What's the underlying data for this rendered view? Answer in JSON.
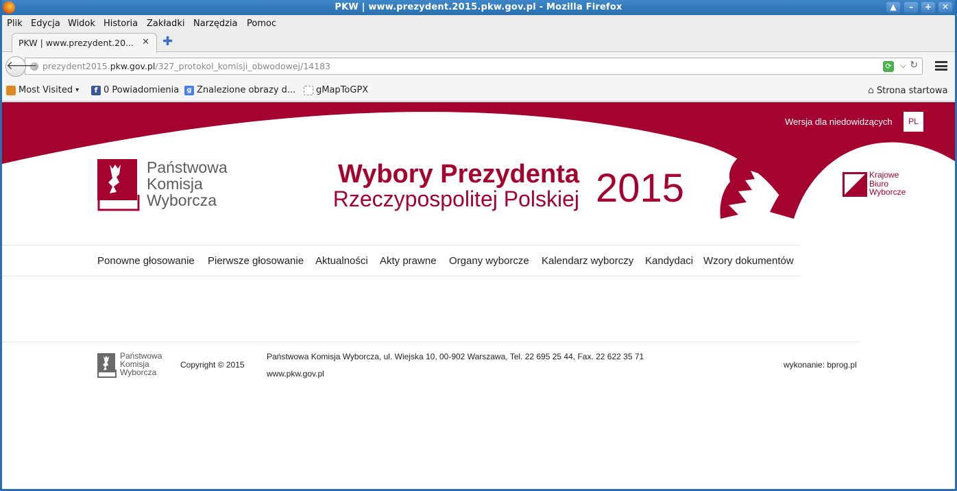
{
  "window": {
    "title": "PKW | www.prezydent.2015.pkw.gov.pl - Mozilla Firefox",
    "controls": [
      "▲",
      "–",
      "+",
      "✕"
    ]
  },
  "menu": [
    "Plik",
    "Edycja",
    "Widok",
    "Historia",
    "Zakładki",
    "Narzędzia",
    "Pomoc"
  ],
  "tab": {
    "title": "PKW | www.prezydent.20...",
    "close": "✕",
    "new_tab": "✚"
  },
  "address": {
    "prefix": "prezydent2015.",
    "domain": "pkw.gov.pl",
    "path": "/327_protokol_komisji_obwodowej/14183"
  },
  "bookmarks": {
    "items": [
      {
        "label": "Most Visited",
        "icon": "folder-icon",
        "color": "#e08a1e"
      },
      {
        "label": "0 Powiadomienia",
        "icon": "facebook-icon",
        "color": "#3b5998"
      },
      {
        "label": "Znalezione obrazy d...",
        "icon": "google-icon",
        "color": "#4a7ef0"
      },
      {
        "label": "gMapToGPX",
        "icon": "page-icon",
        "color": "#cccccc"
      }
    ],
    "home": "Strona startowa"
  },
  "site": {
    "brand_color": "#a4032f",
    "accessibility_link": "Wersja dla niedowidzących",
    "language": "PL",
    "pkw_logo": [
      "Państwowa",
      "Komisja",
      "Wyborcza"
    ],
    "banner_title": "Wybory Prezydenta",
    "banner_subtitle": "Rzeczypospolitej Polskiej",
    "banner_year": "2015",
    "kbw_logo": [
      "Krajowe",
      "Biuro",
      "Wyborcze"
    ],
    "nav": [
      "Ponowne głosowanie",
      "Pierwsze głosowanie",
      "Aktualności",
      "Akty prawne",
      "Organy wyborcze",
      "Kalendarz wyborczy",
      "Kandydaci",
      "Wzory dokumentów"
    ]
  },
  "footer": {
    "logo": [
      "Państwowa",
      "Komisja",
      "Wyborcza"
    ],
    "copyright": "Copyright © 2015",
    "address": "Państwowa Komisja Wyborcza, ul. Wiejska 10, 00-902 Warszawa, Tel. 22 695 25 44, Fax. 22 622 35 71",
    "website": "www.pkw.gov.pl",
    "credits": "wykonanie: bprog.pl"
  }
}
